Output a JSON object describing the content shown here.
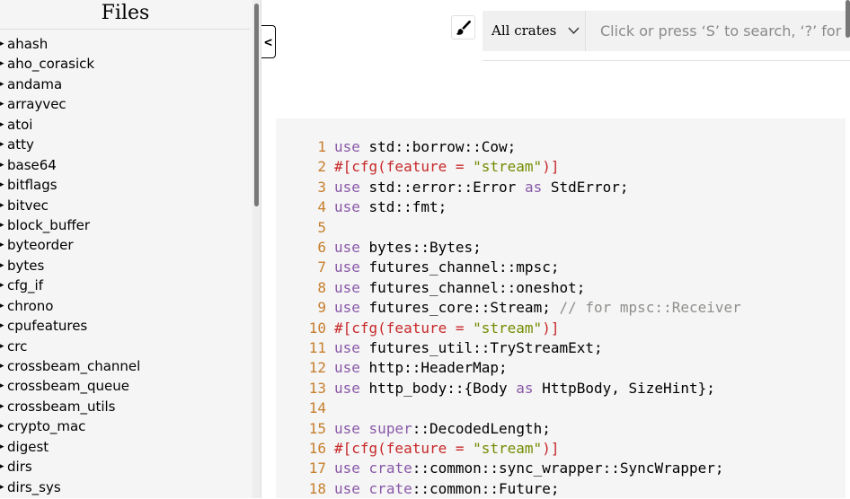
{
  "sidebar": {
    "title": "Files",
    "items": [
      {
        "label": "ahash"
      },
      {
        "label": "aho_corasick"
      },
      {
        "label": "andama"
      },
      {
        "label": "arrayvec"
      },
      {
        "label": "atoi"
      },
      {
        "label": "atty"
      },
      {
        "label": "base64"
      },
      {
        "label": "bitflags"
      },
      {
        "label": "bitvec"
      },
      {
        "label": "block_buffer"
      },
      {
        "label": "byteorder"
      },
      {
        "label": "bytes"
      },
      {
        "label": "cfg_if"
      },
      {
        "label": "chrono"
      },
      {
        "label": "cpufeatures"
      },
      {
        "label": "crc"
      },
      {
        "label": "crossbeam_channel"
      },
      {
        "label": "crossbeam_queue"
      },
      {
        "label": "crossbeam_utils"
      },
      {
        "label": "crypto_mac"
      },
      {
        "label": "digest"
      },
      {
        "label": "dirs"
      },
      {
        "label": "dirs_sys"
      }
    ],
    "arrow": "▸",
    "toggle_label": "<"
  },
  "search": {
    "theme_icon": "paintbrush-icon",
    "crate_select_value": "All crates",
    "placeholder": "Click or press ‘S’ to search, ‘?’ for more options…"
  },
  "code": {
    "lines": [
      {
        "num": "1",
        "tokens": [
          {
            "t": "use",
            "c": "kw"
          },
          {
            "t": " std::borrow::Cow;",
            "c": ""
          }
        ]
      },
      {
        "num": "2",
        "tokens": [
          {
            "t": "#[cfg(feature = ",
            "c": "attr"
          },
          {
            "t": "\"stream\"",
            "c": "str"
          },
          {
            "t": ")]",
            "c": "attr"
          }
        ]
      },
      {
        "num": "3",
        "tokens": [
          {
            "t": "use",
            "c": "kw"
          },
          {
            "t": " std::error::Error ",
            "c": ""
          },
          {
            "t": "as",
            "c": "kw"
          },
          {
            "t": " StdError;",
            "c": ""
          }
        ]
      },
      {
        "num": "4",
        "tokens": [
          {
            "t": "use",
            "c": "kw"
          },
          {
            "t": " std::fmt;",
            "c": ""
          }
        ]
      },
      {
        "num": "5",
        "tokens": []
      },
      {
        "num": "6",
        "tokens": [
          {
            "t": "use",
            "c": "kw"
          },
          {
            "t": " bytes::Bytes;",
            "c": ""
          }
        ]
      },
      {
        "num": "7",
        "tokens": [
          {
            "t": "use",
            "c": "kw"
          },
          {
            "t": " futures_channel::mpsc;",
            "c": ""
          }
        ]
      },
      {
        "num": "8",
        "tokens": [
          {
            "t": "use",
            "c": "kw"
          },
          {
            "t": " futures_channel::oneshot;",
            "c": ""
          }
        ]
      },
      {
        "num": "9",
        "tokens": [
          {
            "t": "use",
            "c": "kw"
          },
          {
            "t": " futures_core::Stream; ",
            "c": ""
          },
          {
            "t": "// for mpsc::Receiver",
            "c": "comment"
          }
        ]
      },
      {
        "num": "10",
        "tokens": [
          {
            "t": "#[cfg(feature = ",
            "c": "attr"
          },
          {
            "t": "\"stream\"",
            "c": "str"
          },
          {
            "t": ")]",
            "c": "attr"
          }
        ]
      },
      {
        "num": "11",
        "tokens": [
          {
            "t": "use",
            "c": "kw"
          },
          {
            "t": " futures_util::TryStreamExt;",
            "c": ""
          }
        ]
      },
      {
        "num": "12",
        "tokens": [
          {
            "t": "use",
            "c": "kw"
          },
          {
            "t": " http::HeaderMap;",
            "c": ""
          }
        ]
      },
      {
        "num": "13",
        "tokens": [
          {
            "t": "use",
            "c": "kw"
          },
          {
            "t": " http_body::{Body ",
            "c": ""
          },
          {
            "t": "as",
            "c": "kw"
          },
          {
            "t": " HttpBody, SizeHint};",
            "c": ""
          }
        ]
      },
      {
        "num": "14",
        "tokens": []
      },
      {
        "num": "15",
        "tokens": [
          {
            "t": "use",
            "c": "kw"
          },
          {
            "t": " ",
            "c": ""
          },
          {
            "t": "super",
            "c": "kw"
          },
          {
            "t": "::DecodedLength;",
            "c": ""
          }
        ]
      },
      {
        "num": "16",
        "tokens": [
          {
            "t": "#[cfg(feature = ",
            "c": "attr"
          },
          {
            "t": "\"stream\"",
            "c": "str"
          },
          {
            "t": ")]",
            "c": "attr"
          }
        ]
      },
      {
        "num": "17",
        "tokens": [
          {
            "t": "use",
            "c": "kw"
          },
          {
            "t": " ",
            "c": ""
          },
          {
            "t": "crate",
            "c": "kw"
          },
          {
            "t": "::common::sync_wrapper::SyncWrapper;",
            "c": ""
          }
        ]
      },
      {
        "num": "18",
        "tokens": [
          {
            "t": "use",
            "c": "kw"
          },
          {
            "t": " ",
            "c": ""
          },
          {
            "t": "crate",
            "c": "kw"
          },
          {
            "t": "::common::Future;",
            "c": ""
          }
        ]
      }
    ]
  },
  "colors": {
    "line_number": "#c67e2d",
    "keyword": "#8959a8",
    "attribute": "#c82829",
    "string": "#718c00",
    "comment": "#8e908c",
    "code_background": "#f5f5f5"
  }
}
